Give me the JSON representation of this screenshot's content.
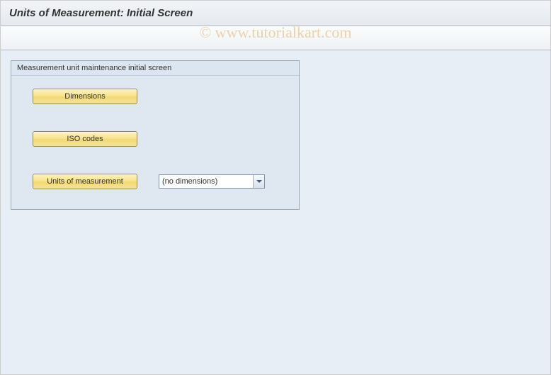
{
  "header": {
    "title": "Units of Measurement: Initial Screen"
  },
  "watermark": "© www.tutorialkart.com",
  "groupbox": {
    "title": "Measurement unit maintenance initial screen",
    "buttons": {
      "dimensions": "Dimensions",
      "iso_codes": "ISO codes",
      "units_of_measurement": "Units of measurement"
    },
    "select": {
      "value": "(no dimensions)"
    }
  }
}
